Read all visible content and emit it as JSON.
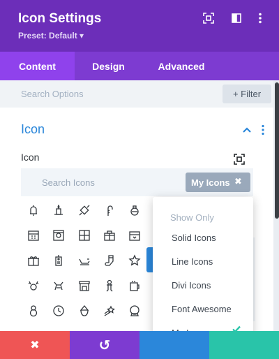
{
  "header": {
    "title": "Icon Settings",
    "preset_label": "Preset: Default",
    "preset_caret": "▾",
    "icons": [
      "expand-icon",
      "sidebar-toggle-icon",
      "more-vertical-icon"
    ],
    "bg_color": "#6c2eb9"
  },
  "tabs": [
    {
      "label": "Content",
      "active": true
    },
    {
      "label": "Design",
      "active": false
    },
    {
      "label": "Advanced",
      "active": false
    }
  ],
  "options_search": {
    "placeholder": "Search Options",
    "filter_label": "+ Filter"
  },
  "section": {
    "title": "Icon",
    "field_label": "Icon"
  },
  "icon_picker": {
    "search_placeholder": "Search Icons",
    "filter_chip": "My Icons",
    "filter_chip_close": "✖",
    "icons": [
      [
        "bell-icon",
        "candle-icon",
        "candy-icon",
        "candy-cane-icon",
        "ornament-icon"
      ],
      [
        "calendar-icon",
        "advent-calendar-icon",
        "window-icon",
        "gift-box-icon",
        "present-icon"
      ],
      [
        "gift-icon",
        "tag-icon",
        "sleigh-icon",
        "stocking-icon",
        "star-icon"
      ],
      [
        "reindeer-icon",
        "reindeer-antlers-icon",
        "fireplace-icon",
        "gingerbread-icon",
        "mug-icon"
      ],
      [
        "snowman-icon",
        "clock-icon",
        "santa-icon",
        "shooting-star-icon",
        "snow-globe-icon"
      ]
    ]
  },
  "dropdown": {
    "heading": "Show Only",
    "items": [
      {
        "label": "Solid Icons",
        "checked": false
      },
      {
        "label": "Line Icons",
        "checked": false
      },
      {
        "label": "Divi Icons",
        "checked": false
      },
      {
        "label": "Font Awesome",
        "checked": false
      },
      {
        "label": "My Icons",
        "checked": true
      }
    ],
    "check_color": "#29c4a9"
  },
  "footer": {
    "buttons": [
      {
        "name": "discard",
        "glyph": "✖",
        "color": "#ef5555"
      },
      {
        "name": "undo",
        "glyph": "↺",
        "color": "#7d3bd1"
      },
      {
        "name": "redo",
        "glyph": "",
        "color": "#2b87da"
      },
      {
        "name": "save",
        "glyph": "",
        "color": "#29c4a9"
      }
    ]
  },
  "colors": {
    "accent_purple": "#8f42ec",
    "accent_blue": "#2b87da",
    "accent_green": "#29c4a9",
    "danger_red": "#ef5555"
  }
}
